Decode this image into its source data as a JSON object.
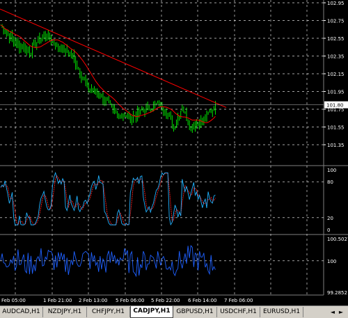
{
  "colors": {
    "background": "#000000",
    "grid": "#ffffff",
    "price_candles": "#00ff00",
    "moving_average": "#ff0000",
    "trendline": "#ff0000",
    "stoch_main": "#20b2ff",
    "stoch_signal": "#ff2020",
    "indicator2_line": "#1e60ff",
    "current_price_line": "#c0c0c0",
    "axis_text": "#ffffff",
    "tab_bg": "#d4d0c8"
  },
  "main_panel": {
    "price_ticks": [
      "102.95",
      "102.75",
      "102.55",
      "102.35",
      "102.15",
      "101.95",
      "101.75",
      "101.55",
      "101.35"
    ],
    "current_price": "101.80"
  },
  "stoch_panel": {
    "ticks": [
      "100",
      "80",
      "20",
      "0"
    ]
  },
  "osc_panel": {
    "ticks": [
      "100.5027",
      "100",
      "99.2852"
    ]
  },
  "time_axis": {
    "labels": [
      "Feb 05:00",
      "1 Feb 21:00",
      "2 Feb 13:00",
      "5 Feb 06:00",
      "5 Feb 22:00",
      "6 Feb 14:00",
      "7 Feb 06:00"
    ]
  },
  "tabs": [
    {
      "label": "AUDCAD,H1",
      "active": false
    },
    {
      "label": "NZDJPY,H1",
      "active": false
    },
    {
      "label": "CHFJPY,H1",
      "active": false
    },
    {
      "label": "CADJPY,H1",
      "active": true
    },
    {
      "label": "GBPUSD,H1",
      "active": false
    },
    {
      "label": "USDCHF,H1",
      "active": false
    },
    {
      "label": "EURUSD,H1",
      "active": false
    }
  ],
  "nav": {
    "left": "◄",
    "right": "►"
  }
}
